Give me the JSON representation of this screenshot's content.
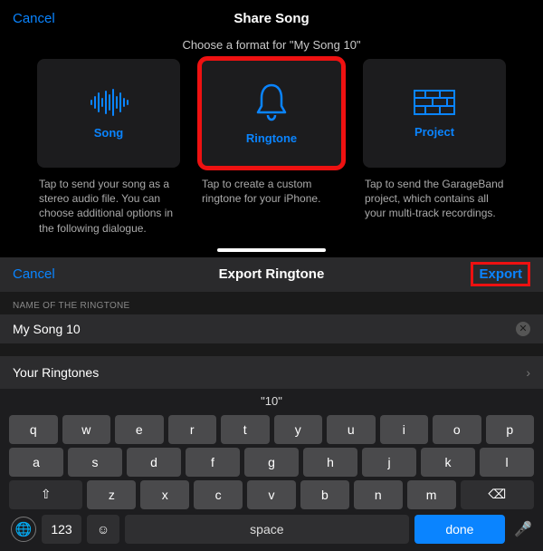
{
  "share": {
    "cancel": "Cancel",
    "title": "Share Song",
    "subtitle": "Choose a format for \"My Song 10\"",
    "cards": [
      {
        "label": "Song",
        "desc": "Tap to send your song as a stereo audio file. You can choose additional options in the following dialogue.",
        "icon": "waveform-icon"
      },
      {
        "label": "Ringtone",
        "desc": "Tap to create a custom ringtone for your iPhone.",
        "icon": "bell-icon",
        "selected": true
      },
      {
        "label": "Project",
        "desc": "Tap to send the GarageBand project, which contains all your multi-track recordings.",
        "icon": "bricks-icon"
      }
    ]
  },
  "export": {
    "cancel": "Cancel",
    "title": "Export Ringtone",
    "action": "Export",
    "sectionLabel": "NAME OF THE RINGTONE",
    "nameValue": "My Song 10",
    "listRow": "Your Ringtones"
  },
  "keyboard": {
    "suggestion": "\"10\"",
    "row1": [
      "q",
      "w",
      "e",
      "r",
      "t",
      "y",
      "u",
      "i",
      "o",
      "p"
    ],
    "row2": [
      "a",
      "s",
      "d",
      "f",
      "g",
      "h",
      "j",
      "k",
      "l"
    ],
    "row3": [
      "z",
      "x",
      "c",
      "v",
      "b",
      "n",
      "m"
    ],
    "shift": "⇧",
    "backspace": "⌫",
    "numKey": "123",
    "emoji": "☺",
    "space": "space",
    "done": "done"
  }
}
